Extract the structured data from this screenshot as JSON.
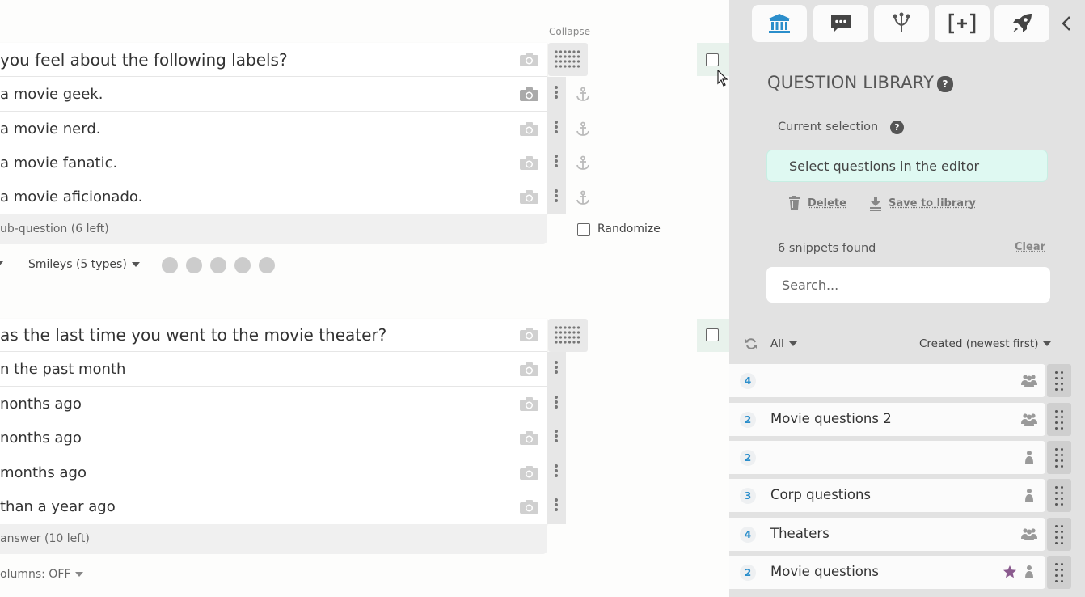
{
  "editor": {
    "collapse_label": "Collapse",
    "question1": {
      "title": "you feel about the following labels?",
      "rows": [
        "a movie geek.",
        "a movie nerd.",
        "a movie fanatic.",
        "a movie aficionado."
      ],
      "add_label": "ub-question (6 left)",
      "randomize_label": "Randomize",
      "scale_type": "Smileys (5 types)"
    },
    "question2": {
      "title": "as the last time you went to the movie theater?",
      "rows": [
        "n the past month",
        "nonths ago",
        "nonths ago",
        "months ago",
        " than a year ago"
      ],
      "add_label": " answer (10 left)",
      "columns_label": "olumns: OFF"
    }
  },
  "panel": {
    "tabs": [
      "library-icon",
      "chat-icon",
      "branch-icon",
      "bracket-plus-icon",
      "rocket-icon"
    ],
    "title": "QUESTION LIBRARY",
    "current_selection_label": "Current selection",
    "selection_text": "Select questions in the editor",
    "delete_label": "Delete",
    "save_label": "Save to library",
    "snippets_found": "6 snippets found",
    "clear_label": "Clear",
    "search_placeholder": "Search...",
    "filter_label": "All",
    "sort_label": "Created (newest first)",
    "snippets": [
      {
        "count": "4",
        "name": "",
        "shared": "group"
      },
      {
        "count": "2",
        "name": "Movie questions 2",
        "shared": "group"
      },
      {
        "count": "2",
        "name": "",
        "shared": "single"
      },
      {
        "count": "3",
        "name": "Corp questions",
        "shared": "single"
      },
      {
        "count": "4",
        "name": "Theaters",
        "shared": "group"
      },
      {
        "count": "2",
        "name": "Movie questions",
        "shared": "single",
        "starred": true
      }
    ]
  },
  "colors": {
    "accent": "#2b8ecb",
    "selection_bg": "#dff9f2",
    "star": "#8a5a8e"
  }
}
